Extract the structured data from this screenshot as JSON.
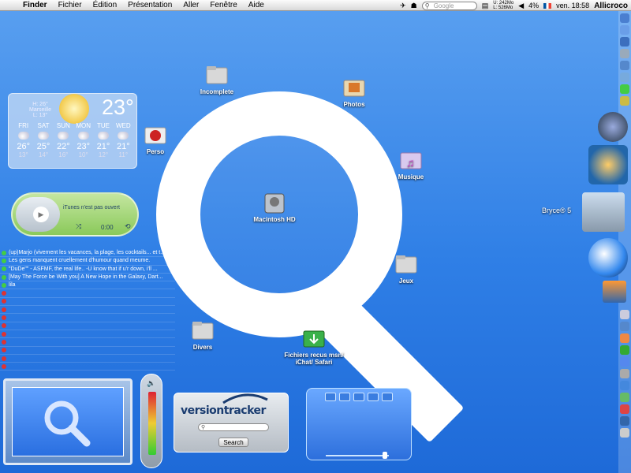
{
  "menubar": {
    "app": "Finder",
    "items": [
      "Fichier",
      "Édition",
      "Présentation",
      "Aller",
      "Fenêtre",
      "Aide"
    ],
    "search_placeholder": "Google",
    "mem_u": "U: 242Mo",
    "mem_l": "L: 526Mo",
    "battery": "4%",
    "datetime": "ven. 18:58",
    "user": "Allicroco"
  },
  "desktop_icons": {
    "incomplete": "Incomplete",
    "photos": "Photos",
    "perso": "Perso",
    "musique": "Musique",
    "macintosh_hd": "Macintosh HD",
    "jeux": "Jeux",
    "divers": "Divers",
    "fichiers": "Fichiers recus msn/ iChat/ Safari"
  },
  "weather": {
    "city": "Marseille",
    "hi": "H: 26°",
    "lo": "L: 13°",
    "temp": "23°",
    "days": [
      {
        "name": "FRI",
        "hi": "26°",
        "lo": "13°"
      },
      {
        "name": "SAT",
        "hi": "25°",
        "lo": "14°"
      },
      {
        "name": "SUN",
        "hi": "22°",
        "lo": "16°"
      },
      {
        "name": "MON",
        "hi": "23°",
        "lo": "10°"
      },
      {
        "name": "TUE",
        "hi": "21°",
        "lo": "12°"
      },
      {
        "name": "WED",
        "hi": "21°",
        "lo": "11°"
      }
    ]
  },
  "itunes": {
    "message": "iTunes n'est pas ouvert",
    "time": "0:00"
  },
  "buddies": [
    {
      "status": "on",
      "text": "(up)Marjo (vivement les vacances, la plage, les cocktails... et t..."
    },
    {
      "status": "on",
      "text": "Les gens manquent cruellement d'humour quand meume."
    },
    {
      "status": "on",
      "text": "\"DuDe\"\" - ASFMF, the real life.. -U know that if u'r down, i'll ..."
    },
    {
      "status": "on",
      "text": "[May The Force be With you] A New Hope in the Galaxy, Dart..."
    },
    {
      "status": "on",
      "text": "lila"
    },
    {
      "status": "off",
      "text": ""
    },
    {
      "status": "off",
      "text": ""
    },
    {
      "status": "off",
      "text": ""
    },
    {
      "status": "off",
      "text": ""
    },
    {
      "status": "off",
      "text": ""
    },
    {
      "status": "off",
      "text": ""
    },
    {
      "status": "off",
      "text": ""
    },
    {
      "status": "off",
      "text": ""
    },
    {
      "status": "off",
      "text": ""
    },
    {
      "status": "off",
      "text": ""
    }
  ],
  "versiontracker": {
    "logo": "versiontracker",
    "search_button": "Search"
  },
  "dock": {
    "bryce_label": "Bryce® 5"
  }
}
